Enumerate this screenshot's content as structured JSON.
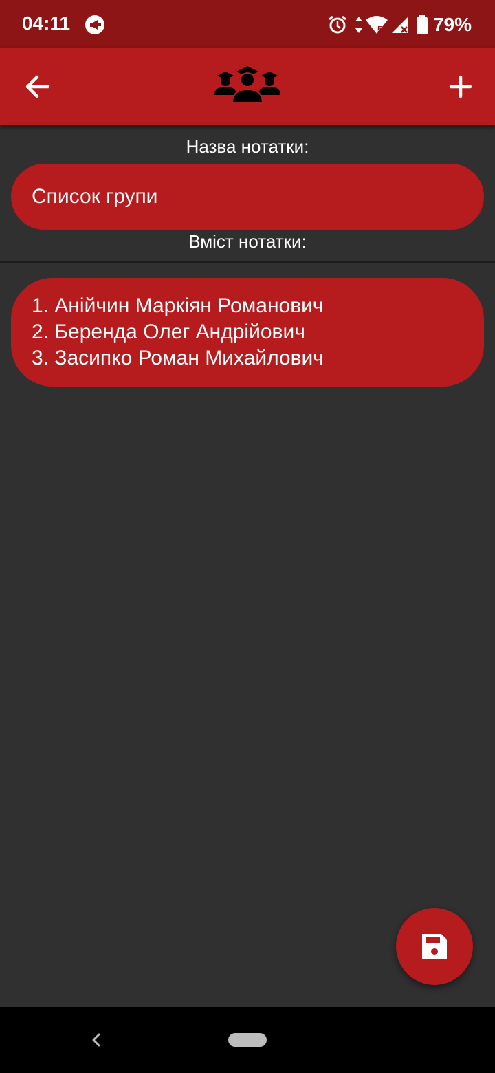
{
  "status_bar": {
    "time": "04:11",
    "battery_percent": "79%",
    "network_label": "5"
  },
  "app_bar": {
    "back_icon": "arrow-left-icon",
    "logo_icon": "graduates-group-icon",
    "add_icon": "plus-icon"
  },
  "note": {
    "title_label": "Назва нотатки:",
    "title_value": "Список групи",
    "content_label": "Вміст нотатки:",
    "content_lines": [
      "1. Анійчин Маркіян Романович",
      "2. Беренда Олег Андрійович",
      "3. Засипко Роман Михайлович"
    ]
  },
  "fab": {
    "icon": "save-icon"
  },
  "colors": {
    "status_bar": "#8e1515",
    "accent": "#b61b1e",
    "background": "#303030"
  }
}
